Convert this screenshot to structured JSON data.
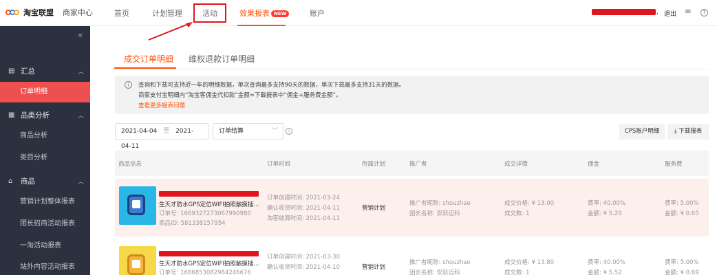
{
  "app": {
    "logo_text": "淘宝联盟",
    "logo_separator": "·",
    "logo_subtitle": "商家中心"
  },
  "topnav": {
    "items": [
      "首页",
      "计划管理",
      "活动",
      "效果报表",
      "账户"
    ],
    "new_badge": "NEW",
    "user_suffix": ",",
    "logout": "退出",
    "icons": [
      "mail-icon",
      "help-icon"
    ]
  },
  "sidebar": {
    "collapse": "«",
    "groups": [
      {
        "label": "汇总",
        "icon": "clipboard-icon",
        "items": [
          "订单明细"
        ]
      },
      {
        "label": "品类分析",
        "icon": "grid-icon",
        "items": [
          "商品分析",
          "类目分析"
        ]
      },
      {
        "label": "商品",
        "icon": "bag-icon",
        "items": [
          "营销计划整体报表",
          "团长招商活动报表",
          "一淘活动报表",
          "站外内容活动报表"
        ]
      }
    ],
    "active_item": "订单明细"
  },
  "tabs": [
    "成交订单明细",
    "维权退款订单明细"
  ],
  "notice": {
    "line1": "查询和下载可支持近一年的明细数据，单次查询最多支持90天的数据，单次下载最多支持31天的数据。",
    "line2": "商家支付宝明细内“淘宝客佣金代扣款”金额=下载报表中“佣金+服务费金额”。",
    "link": "查看更多报表问题"
  },
  "filters": {
    "date_start": "2021-04-04",
    "date_sep": "至",
    "date_end": "2021-04-11",
    "select_value": "订单结算",
    "cps_button": "CPS账户明细",
    "download_button": "下载报表"
  },
  "table": {
    "headers": [
      "商品信息",
      "订单时间",
      "所属计划",
      "推广者",
      "成交详情",
      "佣金",
      "服务费"
    ],
    "rows": [
      {
        "title_line2": "生天才防水GPS定位WIFI拍照触摸插...",
        "order_no": "订单号: 1669327273067990980",
        "product_id": "商品ID: 581338157954",
        "created": "订单创建时间:  2021-03-24",
        "confirmed": "确认收货时间:  2021-04-11",
        "settled": "淘客结算时间:  2021-04-11",
        "plan": "营销计划",
        "promoter": "推广者昵称:  shouzhao",
        "leader": "团长名称:  安跃迈科",
        "price": "成交价格:  ¥ 13.00",
        "count": "成交数:  1",
        "rate": "费率:  40.00%",
        "amount": "金额:  ¥ 5.20",
        "fee_rate": "费率:  5.00%",
        "fee_amount": "金额:  ¥ 0.65"
      },
      {
        "title_line2": "生天才防水GPS定位WIFI拍照触摸插...",
        "order_no": "订单号: 1686853082984246676",
        "created": "订单创建时间:  2021-03-30",
        "confirmed": "确认收货时间:  2021-04-10",
        "plan": "营销计划",
        "promoter": "推广者昵称:  shouzhao",
        "leader": "团长名称:  安跃迈科",
        "price": "成交价格:  ¥ 13.80",
        "count": "成交数:  1",
        "rate": "费率:  40.00%",
        "amount": "金额:  ¥ 5.52",
        "fee_rate": "费率:  5.00%",
        "fee_amount": "金额:  ¥ 0.69"
      }
    ]
  },
  "colors": {
    "accent": "#ff5000",
    "sidebar": "#2c3140",
    "active_item": "#ee4f4f",
    "annotation": "#e0161c"
  }
}
